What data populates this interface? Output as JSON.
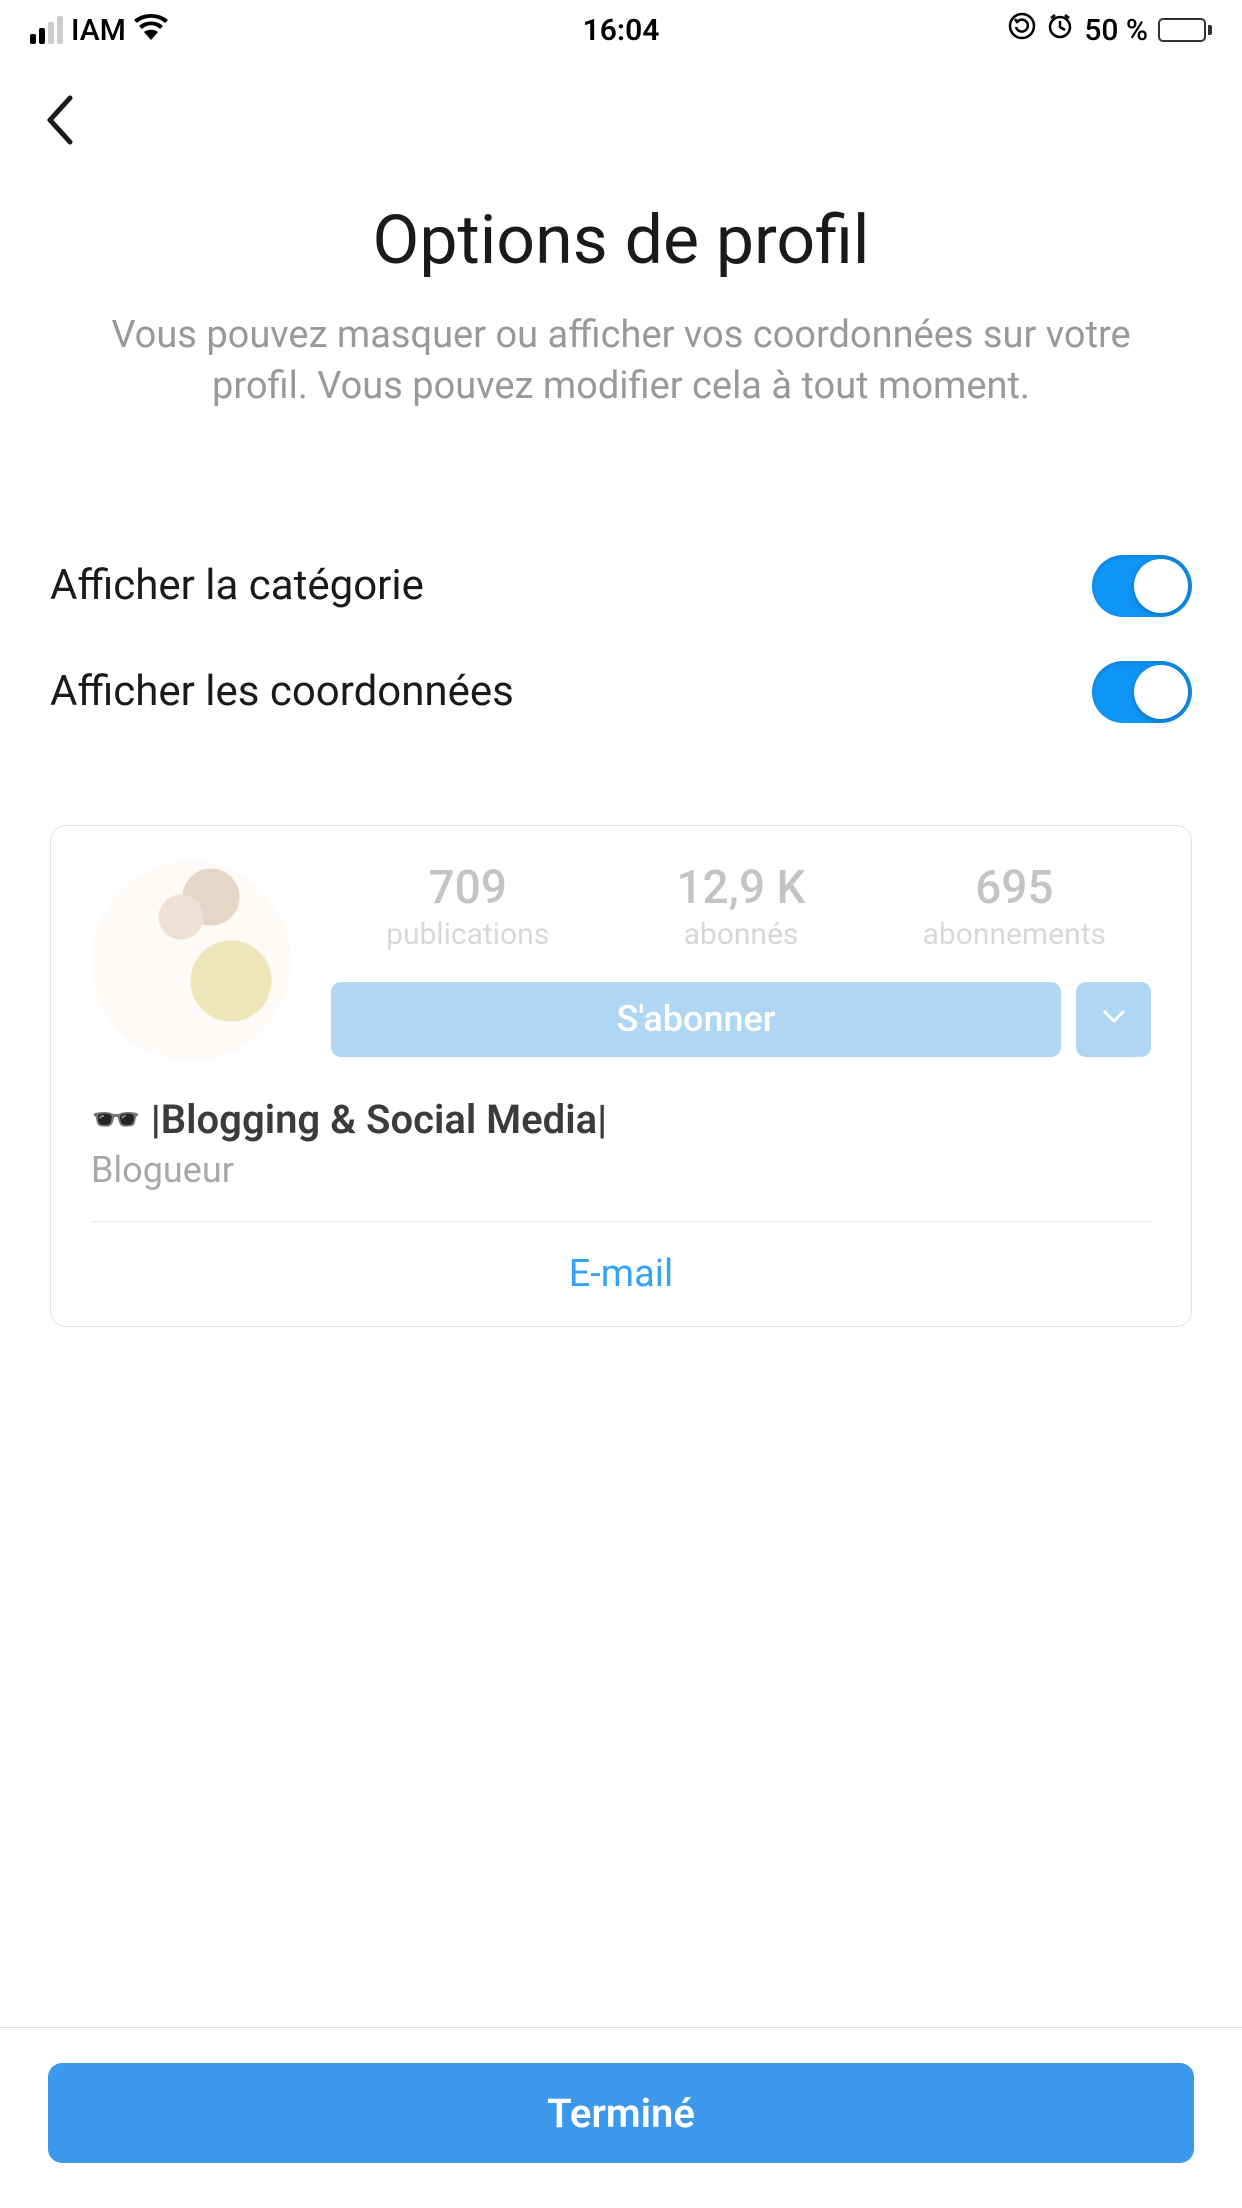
{
  "status_bar": {
    "carrier": "IAM",
    "time": "16:04",
    "battery_pct": "50 %"
  },
  "page": {
    "title": "Options de profil",
    "subtitle": "Vous pouvez masquer ou afficher vos coordonnées sur votre profil. Vous pouvez modifier cela à tout moment."
  },
  "toggles": {
    "show_category_label": "Afficher la catégorie",
    "show_category_on": true,
    "show_contacts_label": "Afficher les coordonnées",
    "show_contacts_on": true
  },
  "profile_preview": {
    "stats": {
      "posts_count": "709",
      "posts_label": "publications",
      "followers_count": "12,9 K",
      "followers_label": "abonnés",
      "following_count": "695",
      "following_label": "abonnements"
    },
    "follow_button": "S'abonner",
    "name_line": "🕶️ |Blogging & Social Media|",
    "category": "Blogueur",
    "email_label": "E-mail"
  },
  "footer": {
    "done_button": "Terminé"
  }
}
